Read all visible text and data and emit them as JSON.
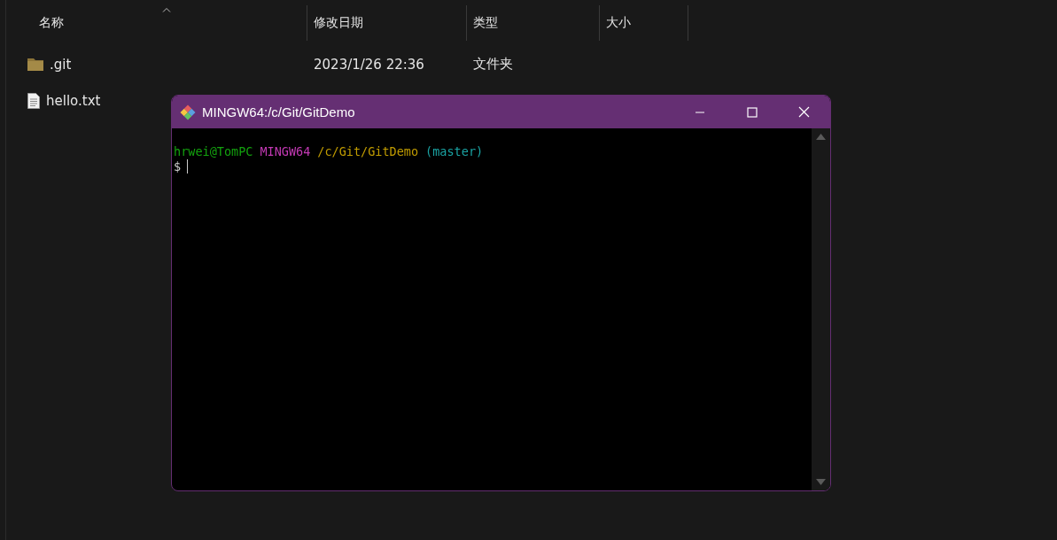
{
  "explorer": {
    "columns": [
      {
        "label": "名称",
        "sorted": true
      },
      {
        "label": "修改日期",
        "sorted": false
      },
      {
        "label": "类型",
        "sorted": false
      },
      {
        "label": "大小",
        "sorted": false
      }
    ],
    "rows": [
      {
        "kind": "folder",
        "name": ".git",
        "modified": "2023/1/26 22:36",
        "type": "文件夹"
      },
      {
        "kind": "file",
        "name": "hello.txt"
      }
    ]
  },
  "terminal": {
    "title": "MINGW64:/c/Git/GitDemo",
    "prompt": [
      {
        "text": "hrwei@TomPC",
        "color": "#13a10e"
      },
      {
        "text": "MINGW64",
        "color": "#c239b3"
      },
      {
        "text": "/c/Git/GitDemo",
        "color": "#c19c00"
      },
      {
        "text": "(master)",
        "color": "#1aa3a3"
      }
    ],
    "input_symbol": "$"
  }
}
